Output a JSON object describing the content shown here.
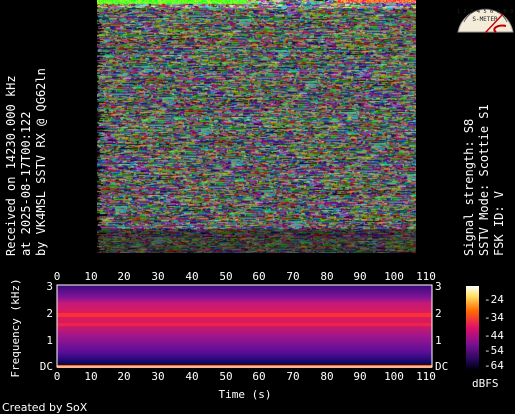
{
  "left_info": {
    "line1": "Received on  14230.000 kHz",
    "line2": "at 2025-08-17T00:122",
    "line3": "by VK4MSL SSTV RX @ QG62ln"
  },
  "right_info": {
    "line1": "Signal strength: S8",
    "line2": "SSTV Mode: Scottie S1",
    "line3": "FSK ID: V"
  },
  "meter": {
    "label": "S-METER",
    "scale_text": "1 2 3 4 5 6 7 8 9",
    "reading": "S8"
  },
  "spectrogram": {
    "x_ticks": [
      "0",
      "10",
      "20",
      "30",
      "40",
      "50",
      "60",
      "70",
      "80",
      "90",
      "100",
      "110"
    ],
    "y_ticks_left": [
      "DC",
      "1",
      "2",
      "3"
    ],
    "y_ticks_right": [
      "DC",
      "1",
      "2",
      "3"
    ],
    "y_label": "Frequency (kHz)",
    "x_label": "Time (s)",
    "colorbar_ticks": [
      "-24",
      "-34",
      "-44",
      "-54",
      "-64"
    ],
    "colorbar_label": "dBFS"
  },
  "footer": "Created by SoX",
  "colors": {
    "background": "#000000",
    "spec_bg": "#5a0a8f",
    "spec_band": "#e0206a",
    "meter_face": "#f4ecd8"
  }
}
